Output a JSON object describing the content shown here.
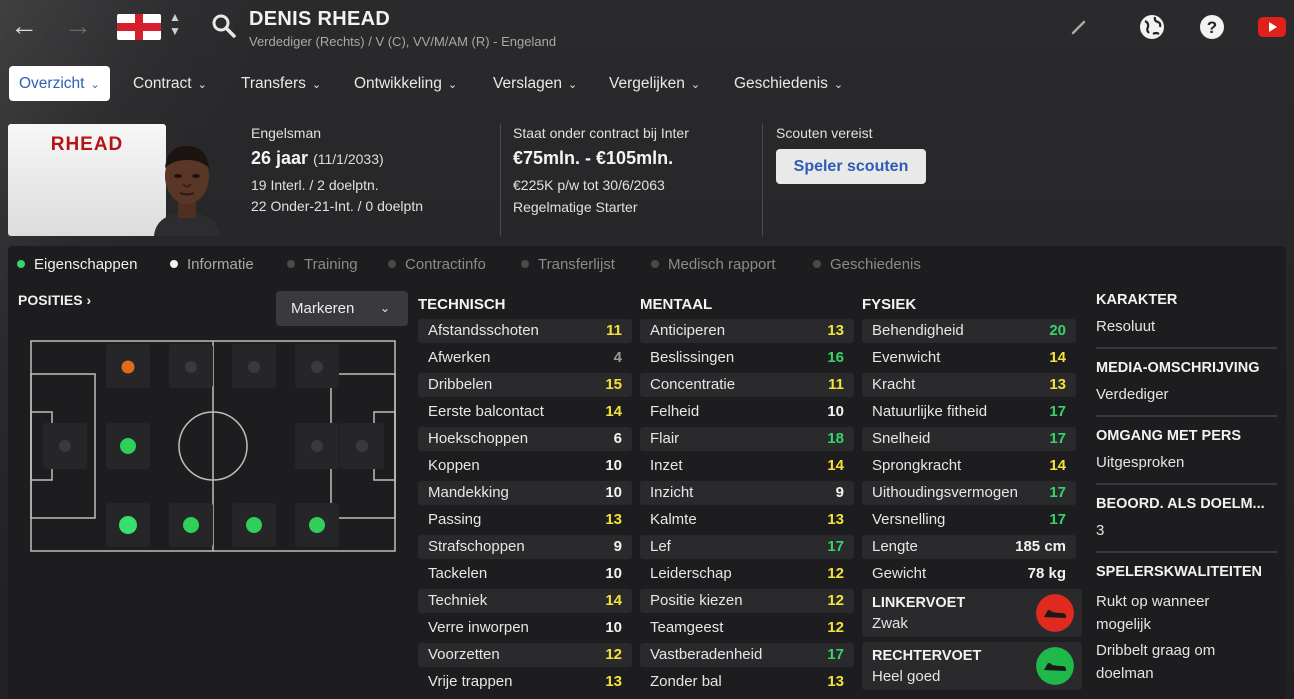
{
  "header": {
    "name": "DENIS RHEAD",
    "subtitle": "Verdediger (Rechts) / V (C), VV/M/AM (R) - Engeland",
    "back_icon": "back-arrow-icon",
    "forward_icon": "forward-arrow-icon",
    "flag": "england-flag-icon"
  },
  "menu": [
    {
      "label": "Overzicht",
      "active": true
    },
    {
      "label": "Contract"
    },
    {
      "label": "Transfers"
    },
    {
      "label": "Ontwikkeling"
    },
    {
      "label": "Verslagen"
    },
    {
      "label": "Vergelijken"
    },
    {
      "label": "Geschiedenis"
    }
  ],
  "card": {
    "name": "RHEAD"
  },
  "profile": {
    "nationality": "Engelsman",
    "age": "26 jaar",
    "dob": "(11/1/2033)",
    "caps": "19 Interl. / 2 doelptn.",
    "u21": "22 Onder-21-Int. / 0 doelptn"
  },
  "contract": {
    "club": "Staat onder contract bij Inter",
    "value": "€75mln. - €105mln.",
    "wage": "€225K p/w tot 30/6/2063",
    "role": "Regelmatige Starter"
  },
  "scout": {
    "label": "Scouten vereist",
    "button": "Speler scouten"
  },
  "subtabs": [
    {
      "label": "Eigenschappen",
      "state": "active"
    },
    {
      "label": "Informatie",
      "state": "white"
    },
    {
      "label": "Training"
    },
    {
      "label": "Contractinfo"
    },
    {
      "label": "Transferlijst"
    },
    {
      "label": "Medisch rapport"
    },
    {
      "label": "Geschiedenis"
    }
  ],
  "positions": {
    "title": "POSITIES",
    "marker_label": "Markeren"
  },
  "attributes": {
    "technisch": {
      "title": "TECHNISCH",
      "rows": [
        [
          "Afstandsschoten",
          "11"
        ],
        [
          "Afwerken",
          "4"
        ],
        [
          "Dribbelen",
          "15"
        ],
        [
          "Eerste balcontact",
          "14"
        ],
        [
          "Hoekschoppen",
          "6"
        ],
        [
          "Koppen",
          "10"
        ],
        [
          "Mandekking",
          "10"
        ],
        [
          "Passing",
          "13"
        ],
        [
          "Strafschoppen",
          "9"
        ],
        [
          "Tackelen",
          "10"
        ],
        [
          "Techniek",
          "14"
        ],
        [
          "Verre inworpen",
          "10"
        ],
        [
          "Voorzetten",
          "12"
        ],
        [
          "Vrije trappen",
          "13"
        ]
      ]
    },
    "mentaal": {
      "title": "MENTAAL",
      "rows": [
        [
          "Anticiperen",
          "13"
        ],
        [
          "Beslissingen",
          "16"
        ],
        [
          "Concentratie",
          "11"
        ],
        [
          "Felheid",
          "10"
        ],
        [
          "Flair",
          "18"
        ],
        [
          "Inzet",
          "14"
        ],
        [
          "Inzicht",
          "9"
        ],
        [
          "Kalmte",
          "13"
        ],
        [
          "Lef",
          "17"
        ],
        [
          "Leiderschap",
          "12"
        ],
        [
          "Positie kiezen",
          "12"
        ],
        [
          "Teamgeest",
          "12"
        ],
        [
          "Vastberadenheid",
          "17"
        ],
        [
          "Zonder bal",
          "13"
        ]
      ]
    },
    "fysiek": {
      "title": "FYSIEK",
      "rows": [
        [
          "Behendigheid",
          "20"
        ],
        [
          "Evenwicht",
          "14"
        ],
        [
          "Kracht",
          "13"
        ],
        [
          "Natuurlijke fitheid",
          "17"
        ],
        [
          "Snelheid",
          "17"
        ],
        [
          "Sprongkracht",
          "14"
        ],
        [
          "Uithoudingsvermogen",
          "17"
        ],
        [
          "Versnelling",
          "17"
        ],
        [
          "Lengte",
          "185 cm"
        ],
        [
          "Gewicht",
          "78 kg"
        ]
      ]
    }
  },
  "feet": {
    "left_title": "LINKERVOET",
    "left_value": "Zwak",
    "left_color": "#e0291f",
    "right_title": "RECHTERVOET",
    "right_value": "Heel goed",
    "right_color": "#1fb84a"
  },
  "right_col": {
    "karakter_title": "KARAKTER",
    "karakter": "Resoluut",
    "media_title": "MEDIA-OMSCHRIJVING",
    "media": "Verdediger",
    "pers_title": "OMGANG MET PERS",
    "pers": "Uitgesproken",
    "keeper_title": "BEOORD. ALS DOELM...",
    "keeper": "3",
    "qual_title": "SPELERSKWALITEITEN",
    "qualities": [
      "Rukt op wanneer mogelijk",
      "Dribbelt graag om doelman"
    ]
  },
  "colors": {
    "val_low": "#9a9a9a",
    "val_mid": "#f2f2f2",
    "val_good": "#f4e23a",
    "val_high": "#36d36a",
    "accent": "#2f5fb8"
  }
}
